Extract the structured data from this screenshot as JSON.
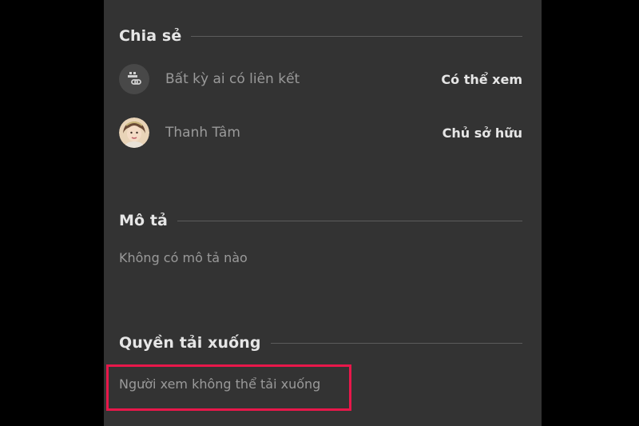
{
  "colors": {
    "background": "#000000",
    "panel": "#333333",
    "heading": "#e6e6e6",
    "muted_text": "#9a9a9a",
    "divider": "#5c5c5c",
    "highlight": "#e8174a"
  },
  "sharing": {
    "title": "Chia sẻ",
    "entries": [
      {
        "icon": "link-people-icon",
        "name": "Bất kỳ ai có liên kết",
        "role": "Có thể xem"
      },
      {
        "icon": "user-avatar",
        "name": "Thanh Tâm",
        "role": "Chủ sở hữu"
      }
    ]
  },
  "description": {
    "title": "Mô tả",
    "text": "Không có mô tả nào"
  },
  "download": {
    "title": "Quyền tải xuống",
    "text": "Người xem không thể tải xuống",
    "highlighted": true
  }
}
